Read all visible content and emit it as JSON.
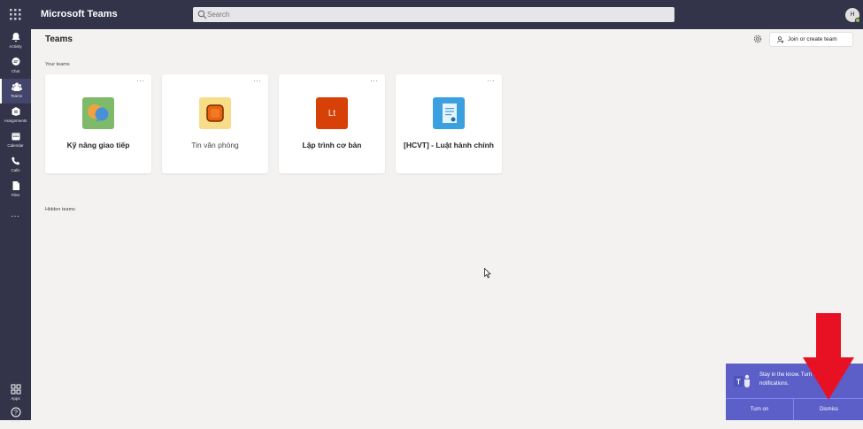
{
  "app": {
    "title": "Microsoft Teams",
    "avatar_initials": "H"
  },
  "search": {
    "placeholder": "Search"
  },
  "rail": {
    "items": [
      {
        "label": "Activity",
        "icon": "bell-icon"
      },
      {
        "label": "Chat",
        "icon": "chat-icon"
      },
      {
        "label": "Teams",
        "icon": "teams-icon"
      },
      {
        "label": "Assignments",
        "icon": "assignments-icon"
      },
      {
        "label": "Calendar",
        "icon": "calendar-icon"
      },
      {
        "label": "Calls",
        "icon": "phone-icon"
      },
      {
        "label": "Files",
        "icon": "file-icon"
      }
    ],
    "more": "···",
    "apps_label": "Apps",
    "help_label": "Help"
  },
  "main": {
    "title": "Teams",
    "join_button": "Join or create team",
    "your_teams_label": "Your teams",
    "hidden_teams_label": "Hidden teams",
    "teams": [
      {
        "name": "Kỹ năng giao tiếp",
        "icon": "chat-bubbles-icon",
        "color": "#7fba6b"
      },
      {
        "name": "Tin văn phòng",
        "icon": "orange-square-icon",
        "color": "#f7dd88"
      },
      {
        "name": "Lập trình cơ bản",
        "icon": "lt-tile-icon",
        "color": "#d74108",
        "initials": "Lt"
      },
      {
        "name": "[HCVT] - Luật hành chính",
        "icon": "document-icon",
        "color": "#3aa0e0"
      }
    ]
  },
  "toast": {
    "text": "Stay in the know. Turn on desktop notifications.",
    "turn_on": "Turn on",
    "dismiss": "Dismiss"
  },
  "colors": {
    "rail": "#33344a",
    "accent": "#5b5fc7",
    "arrow": "#e81123"
  }
}
